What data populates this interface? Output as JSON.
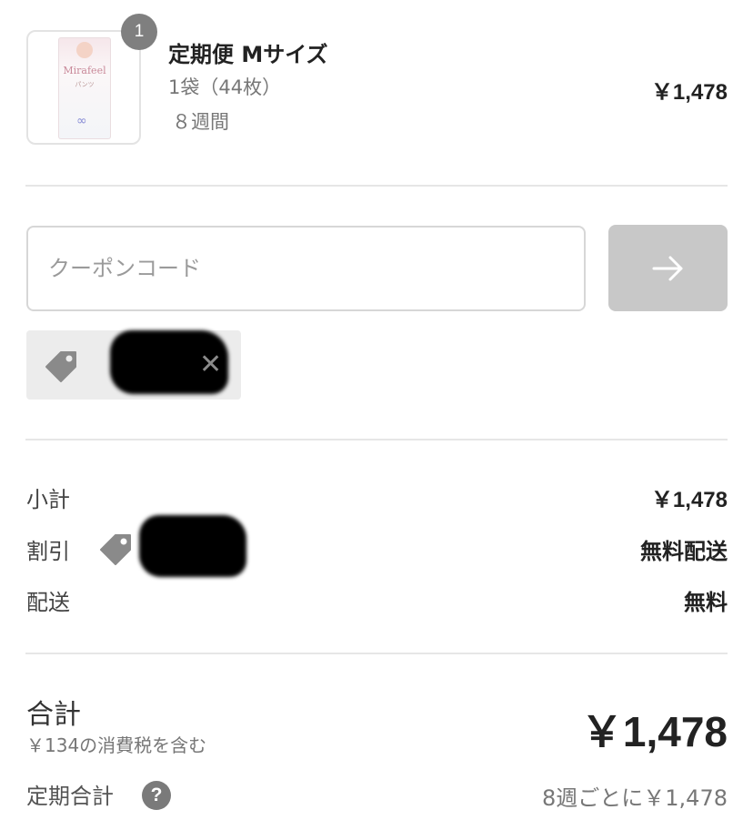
{
  "product": {
    "quantity_badge": "1",
    "title": "定期便 Mサイズ",
    "variant": "1袋（44枚）",
    "interval": "８週間",
    "price": "￥1,478",
    "image": {
      "brand": "Mirafeel",
      "sub": "パンツ"
    }
  },
  "coupon": {
    "placeholder": "クーポンコード",
    "apply_icon": "arrow-right-icon",
    "applied_tag_icon": "tag-icon",
    "remove_icon": "close-icon"
  },
  "summary": {
    "subtotal_label": "小計",
    "subtotal_value": "￥1,478",
    "discount_label": "割引",
    "discount_value": "無料配送",
    "shipping_label": "配送",
    "shipping_value": "無料"
  },
  "total": {
    "label": "合計",
    "tax_note": "￥134の消費税を含む",
    "value": "￥1,478"
  },
  "subscription": {
    "label": "定期合計",
    "help_icon": "?",
    "value": "8週ごとに￥1,478"
  },
  "colors": {
    "button_disabled": "#c8c8c8",
    "chip_bg": "#ececec",
    "badge_bg": "#7f7f7f"
  }
}
